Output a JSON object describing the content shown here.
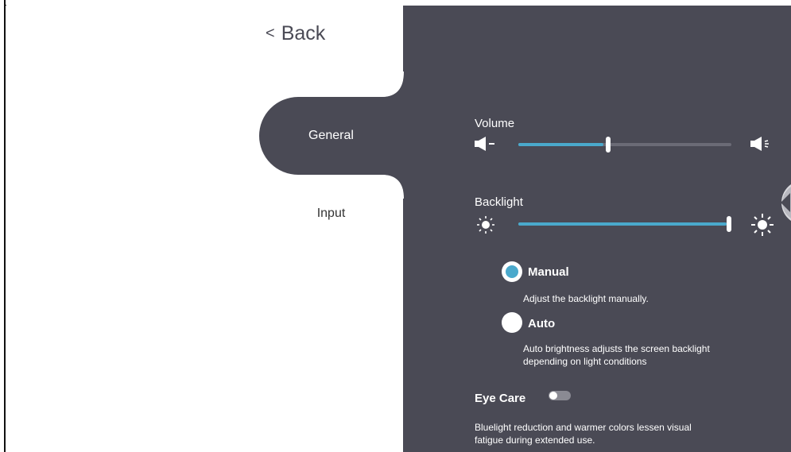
{
  "nav": {
    "back_label": "Back",
    "tabs": [
      {
        "label": "General",
        "active": true
      },
      {
        "label": "Input",
        "active": false
      }
    ]
  },
  "volume": {
    "label": "Volume",
    "level_percent": 42,
    "low_icon": "speaker-low-icon",
    "high_icon": "speaker-high-icon"
  },
  "backlight": {
    "label": "Backlight",
    "level_percent": 100,
    "low_icon": "brightness-low-icon",
    "high_icon": "brightness-high-icon",
    "modes": [
      {
        "label": "Manual",
        "description": "Adjust the backlight manually.",
        "selected": true
      },
      {
        "label": "Auto",
        "description_line1": "Auto brightness adjusts the screen backlight",
        "description_line2": "depending on light conditions",
        "selected": false
      }
    ]
  },
  "eye_care": {
    "label": "Eye Care",
    "enabled": false,
    "description_line1": "Bluelight reduction and warmer colors lessen visual",
    "description_line2": "fatigue during extended use."
  },
  "colors": {
    "panel": "#4a4a55",
    "accent": "#4aa9cc",
    "track": "#6b6b76"
  }
}
